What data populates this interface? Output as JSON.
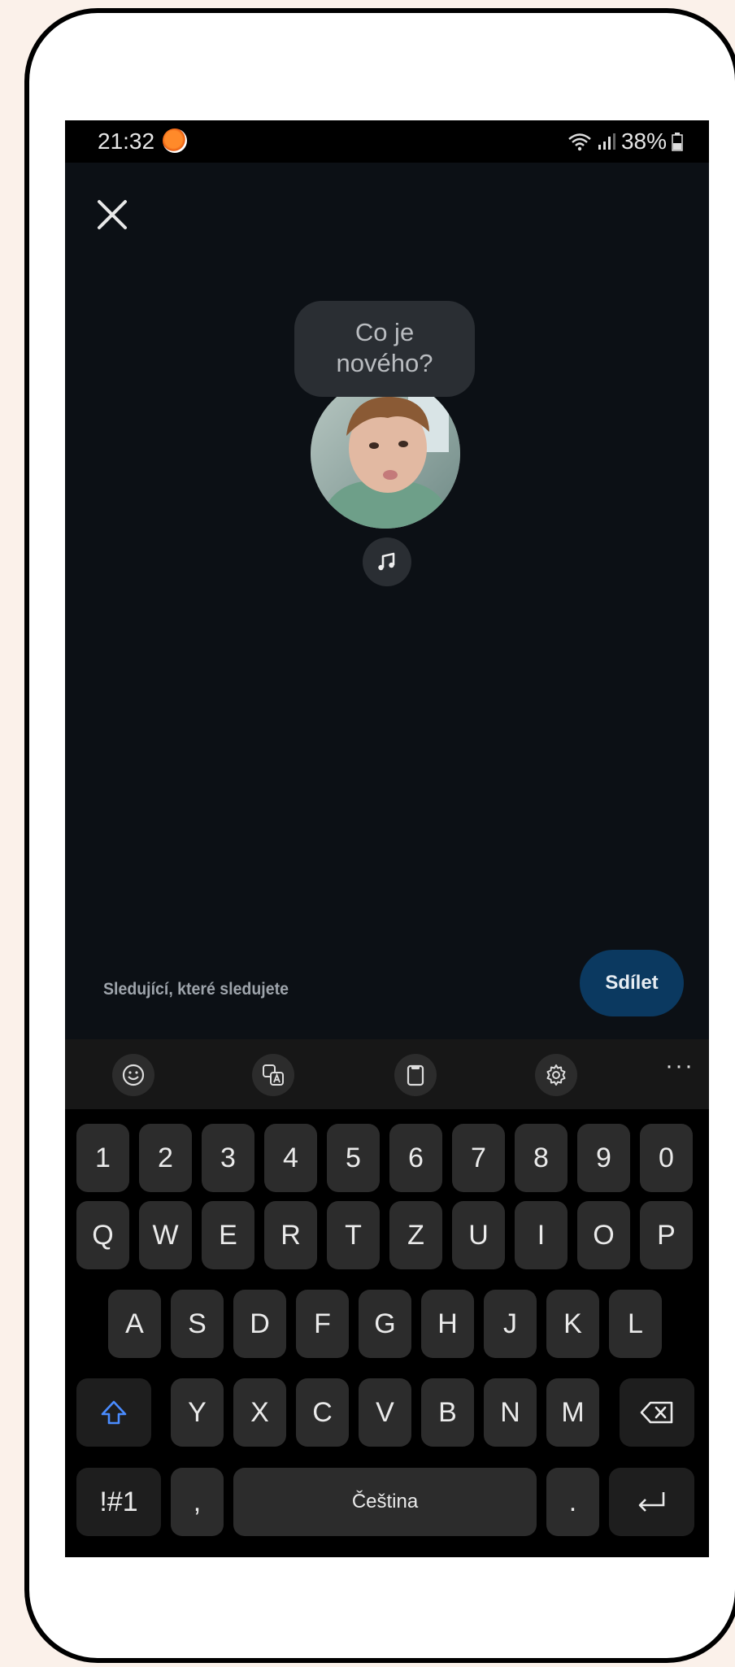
{
  "status": {
    "time": "21:32",
    "battery": "38%"
  },
  "compose": {
    "prompt": "Co je\nnového?",
    "audience": "Sledující, které sledujete",
    "share_label": "Sdílet"
  },
  "icons": {
    "close": "close-icon",
    "music": "music-note-icon",
    "emoji": "emoji-icon",
    "translate": "translate-icon",
    "clipboard": "clipboard-icon",
    "settings": "gear-icon",
    "shift": "shift-icon",
    "backspace": "backspace-icon",
    "enter": "enter-icon"
  },
  "keyboard": {
    "more": "···",
    "row_numbers": [
      "1",
      "2",
      "3",
      "4",
      "5",
      "6",
      "7",
      "8",
      "9",
      "0"
    ],
    "row_top": [
      "Q",
      "W",
      "E",
      "R",
      "T",
      "Z",
      "U",
      "I",
      "O",
      "P"
    ],
    "row_home": [
      "A",
      "S",
      "D",
      "F",
      "G",
      "H",
      "J",
      "K",
      "L"
    ],
    "row_bottom": [
      "Y",
      "X",
      "C",
      "V",
      "B",
      "N",
      "M"
    ],
    "symbols": "!#1",
    "comma": ",",
    "space": "Čeština",
    "period": "."
  },
  "colors": {
    "background": "#0c1015",
    "share_button": "#0b3960",
    "shift_accent": "#4a8cff"
  }
}
